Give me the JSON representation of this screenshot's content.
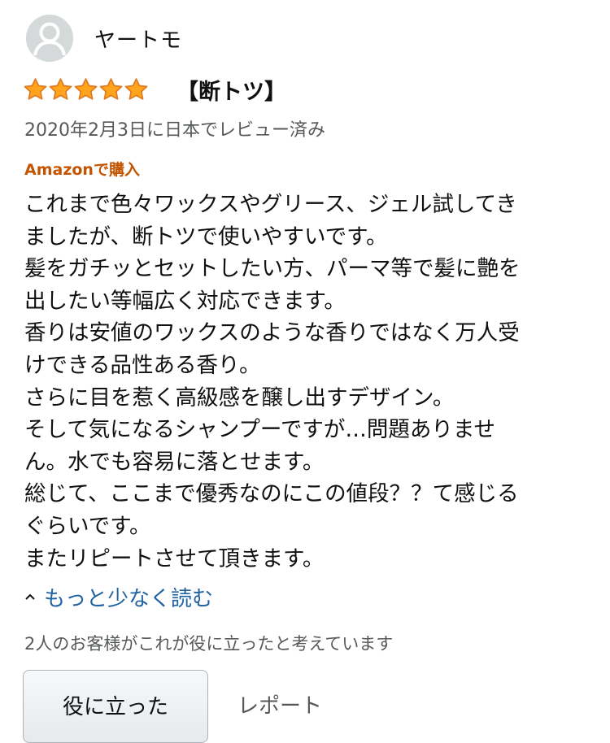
{
  "reviewer": {
    "name": "ヤートモ",
    "avatar_icon": "default-user-avatar-icon"
  },
  "rating": {
    "stars": 5,
    "max": 5,
    "star_color": "#ffa41c"
  },
  "review": {
    "title": "【断トツ】",
    "date": "2020年2月3日に日本でレビュー済み",
    "verified_label": "Amazonで購入",
    "body_lines": [
      "これまで色々ワックスやグリース、ジェル試してき",
      "ましたが、断トツで使いやすいです。",
      "髪をガチッとセットしたい方、パーマ等で髪に艶を",
      "出したい等幅広く対応できます。",
      "香りは安値のワックスのような香りではなく万人受",
      "けできる品性ある香り。",
      "さらに目を惹く高級感を醸し出すデザイン。",
      "そして気になるシャンプーですが…問題ありませ",
      "ん。水でも容易に落とせます。",
      "総じて、ここまで優秀なのにこの値段？？て感じる",
      "ぐらいです。",
      "またリピートさせて頂きます。"
    ],
    "read_less_label": "もっと少なく読む",
    "helpful_text": "2人のお客様がこれが役に立ったと考えています",
    "helpful_button_label": "役に立った",
    "report_label": "レポート"
  },
  "colors": {
    "link": "#2162a1",
    "verified": "#c45500",
    "muted": "#565959"
  }
}
